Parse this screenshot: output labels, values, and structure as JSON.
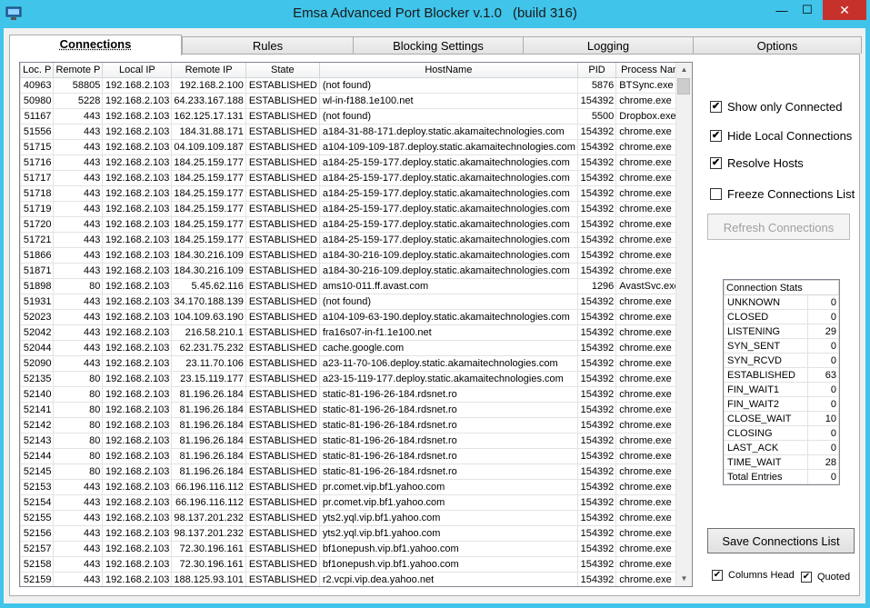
{
  "window": {
    "title": "Emsa Advanced Port Blocker v.1.0",
    "build": "(build 316)"
  },
  "tabs": [
    "Connections",
    "Rules",
    "Blocking Settings",
    "Logging",
    "Options"
  ],
  "table": {
    "columns": [
      "Loc. P",
      "Remote P",
      "Local IP",
      "Remote IP",
      "State",
      "HostName",
      "PID",
      "Process Name"
    ],
    "rows": [
      [
        "40963",
        "58805",
        "192.168.2.103",
        "192.168.2.100",
        "ESTABLISHED",
        "(not found)",
        "5876",
        "BTSync.exe"
      ],
      [
        "50980",
        "5228",
        "192.168.2.103",
        "64.233.167.188",
        "ESTABLISHED",
        "wl-in-f188.1e100.net",
        "154392",
        "chrome.exe"
      ],
      [
        "51167",
        "443",
        "192.168.2.103",
        "162.125.17.131",
        "ESTABLISHED",
        "(not found)",
        "5500",
        "Dropbox.exe"
      ],
      [
        "51556",
        "443",
        "192.168.2.103",
        "184.31.88.171",
        "ESTABLISHED",
        "a184-31-88-171.deploy.static.akamaitechnologies.com",
        "154392",
        "chrome.exe"
      ],
      [
        "51715",
        "443",
        "192.168.2.103",
        "04.109.109.187",
        "ESTABLISHED",
        "a104-109-109-187.deploy.static.akamaitechnologies.com",
        "154392",
        "chrome.exe"
      ],
      [
        "51716",
        "443",
        "192.168.2.103",
        "184.25.159.177",
        "ESTABLISHED",
        "a184-25-159-177.deploy.static.akamaitechnologies.com",
        "154392",
        "chrome.exe"
      ],
      [
        "51717",
        "443",
        "192.168.2.103",
        "184.25.159.177",
        "ESTABLISHED",
        "a184-25-159-177.deploy.static.akamaitechnologies.com",
        "154392",
        "chrome.exe"
      ],
      [
        "51718",
        "443",
        "192.168.2.103",
        "184.25.159.177",
        "ESTABLISHED",
        "a184-25-159-177.deploy.static.akamaitechnologies.com",
        "154392",
        "chrome.exe"
      ],
      [
        "51719",
        "443",
        "192.168.2.103",
        "184.25.159.177",
        "ESTABLISHED",
        "a184-25-159-177.deploy.static.akamaitechnologies.com",
        "154392",
        "chrome.exe"
      ],
      [
        "51720",
        "443",
        "192.168.2.103",
        "184.25.159.177",
        "ESTABLISHED",
        "a184-25-159-177.deploy.static.akamaitechnologies.com",
        "154392",
        "chrome.exe"
      ],
      [
        "51721",
        "443",
        "192.168.2.103",
        "184.25.159.177",
        "ESTABLISHED",
        "a184-25-159-177.deploy.static.akamaitechnologies.com",
        "154392",
        "chrome.exe"
      ],
      [
        "51866",
        "443",
        "192.168.2.103",
        "184.30.216.109",
        "ESTABLISHED",
        "a184-30-216-109.deploy.static.akamaitechnologies.com",
        "154392",
        "chrome.exe"
      ],
      [
        "51871",
        "443",
        "192.168.2.103",
        "184.30.216.109",
        "ESTABLISHED",
        "a184-30-216-109.deploy.static.akamaitechnologies.com",
        "154392",
        "chrome.exe"
      ],
      [
        "51898",
        "80",
        "192.168.2.103",
        "5.45.62.116",
        "ESTABLISHED",
        "ams10-011.ff.avast.com",
        "1296",
        "AvastSvc.exe"
      ],
      [
        "51931",
        "443",
        "192.168.2.103",
        "34.170.188.139",
        "ESTABLISHED",
        "(not found)",
        "154392",
        "chrome.exe"
      ],
      [
        "52023",
        "443",
        "192.168.2.103",
        "104.109.63.190",
        "ESTABLISHED",
        "a104-109-63-190.deploy.static.akamaitechnologies.com",
        "154392",
        "chrome.exe"
      ],
      [
        "52042",
        "443",
        "192.168.2.103",
        "216.58.210.1",
        "ESTABLISHED",
        "fra16s07-in-f1.1e100.net",
        "154392",
        "chrome.exe"
      ],
      [
        "52044",
        "443",
        "192.168.2.103",
        "62.231.75.232",
        "ESTABLISHED",
        "cache.google.com",
        "154392",
        "chrome.exe"
      ],
      [
        "52090",
        "443",
        "192.168.2.103",
        "23.11.70.106",
        "ESTABLISHED",
        "a23-11-70-106.deploy.static.akamaitechnologies.com",
        "154392",
        "chrome.exe"
      ],
      [
        "52135",
        "80",
        "192.168.2.103",
        "23.15.119.177",
        "ESTABLISHED",
        "a23-15-119-177.deploy.static.akamaitechnologies.com",
        "154392",
        "chrome.exe"
      ],
      [
        "52140",
        "80",
        "192.168.2.103",
        "81.196.26.184",
        "ESTABLISHED",
        "static-81-196-26-184.rdsnet.ro",
        "154392",
        "chrome.exe"
      ],
      [
        "52141",
        "80",
        "192.168.2.103",
        "81.196.26.184",
        "ESTABLISHED",
        "static-81-196-26-184.rdsnet.ro",
        "154392",
        "chrome.exe"
      ],
      [
        "52142",
        "80",
        "192.168.2.103",
        "81.196.26.184",
        "ESTABLISHED",
        "static-81-196-26-184.rdsnet.ro",
        "154392",
        "chrome.exe"
      ],
      [
        "52143",
        "80",
        "192.168.2.103",
        "81.196.26.184",
        "ESTABLISHED",
        "static-81-196-26-184.rdsnet.ro",
        "154392",
        "chrome.exe"
      ],
      [
        "52144",
        "80",
        "192.168.2.103",
        "81.196.26.184",
        "ESTABLISHED",
        "static-81-196-26-184.rdsnet.ro",
        "154392",
        "chrome.exe"
      ],
      [
        "52145",
        "80",
        "192.168.2.103",
        "81.196.26.184",
        "ESTABLISHED",
        "static-81-196-26-184.rdsnet.ro",
        "154392",
        "chrome.exe"
      ],
      [
        "52153",
        "443",
        "192.168.2.103",
        "66.196.116.112",
        "ESTABLISHED",
        "pr.comet.vip.bf1.yahoo.com",
        "154392",
        "chrome.exe"
      ],
      [
        "52154",
        "443",
        "192.168.2.103",
        "66.196.116.112",
        "ESTABLISHED",
        "pr.comet.vip.bf1.yahoo.com",
        "154392",
        "chrome.exe"
      ],
      [
        "52155",
        "443",
        "192.168.2.103",
        "98.137.201.232",
        "ESTABLISHED",
        "yts2.yql.vip.bf1.yahoo.com",
        "154392",
        "chrome.exe"
      ],
      [
        "52156",
        "443",
        "192.168.2.103",
        "98.137.201.232",
        "ESTABLISHED",
        "yts2.yql.vip.bf1.yahoo.com",
        "154392",
        "chrome.exe"
      ],
      [
        "52157",
        "443",
        "192.168.2.103",
        "72.30.196.161",
        "ESTABLISHED",
        "bf1onepush.vip.bf1.yahoo.com",
        "154392",
        "chrome.exe"
      ],
      [
        "52158",
        "443",
        "192.168.2.103",
        "72.30.196.161",
        "ESTABLISHED",
        "bf1onepush.vip.bf1.yahoo.com",
        "154392",
        "chrome.exe"
      ],
      [
        "52159",
        "443",
        "192.168.2.103",
        "188.125.93.101",
        "ESTABLISHED",
        "r2.vcpi.vip.dea.yahoo.net",
        "154392",
        "chrome.exe"
      ]
    ]
  },
  "options": {
    "show_only_connected": "Show only Connected",
    "hide_local": "Hide Local Connections",
    "resolve_hosts": "Resolve Hosts",
    "freeze_list": "Freeze Connections List",
    "refresh_button": "Refresh Connections"
  },
  "stats": {
    "header": "Connection Stats",
    "rows": [
      [
        "UNKNOWN",
        "0"
      ],
      [
        "CLOSED",
        "0"
      ],
      [
        "LISTENING",
        "29"
      ],
      [
        "SYN_SENT",
        "0"
      ],
      [
        "SYN_RCVD",
        "0"
      ],
      [
        "ESTABLISHED",
        "63"
      ],
      [
        "FIN_WAIT1",
        "0"
      ],
      [
        "FIN_WAIT2",
        "0"
      ],
      [
        "CLOSE_WAIT",
        "10"
      ],
      [
        "CLOSING",
        "0"
      ],
      [
        "LAST_ACK",
        "0"
      ],
      [
        "TIME_WAIT",
        "28"
      ],
      [
        "Total Entries",
        "0"
      ]
    ]
  },
  "save": {
    "button": "Save Connections List",
    "columns_head": "Columns Head",
    "quoted": "Quoted"
  },
  "glyphs": {
    "check": "✔",
    "minimize": "—",
    "maximize": "☐",
    "close": "✕",
    "scroll_up": "▲",
    "scroll_down": "▼"
  },
  "colors": {
    "titlebar": "#40c4ea",
    "close_button": "#c7312b"
  }
}
